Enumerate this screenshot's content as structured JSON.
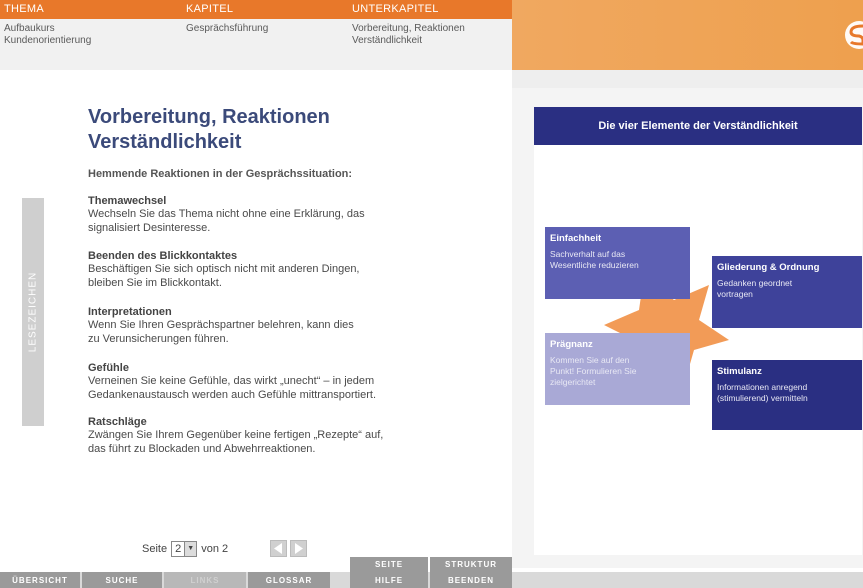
{
  "header": {
    "thema_label": "THEMA",
    "kapitel_label": "KAPITEL",
    "unterkapitel_label": "UNTERKAPITEL",
    "thema_value": "Aufbaukurs\nKundenorientierung",
    "kapitel_value": "Gesprächsführung",
    "unterkapitel_value": "Vorbereitung, Reaktionen\nVerständlichkeit"
  },
  "bookmark": {
    "label": "LESEZEICHEN"
  },
  "content": {
    "title": "Vorbereitung, Reaktionen Verständlichkeit",
    "subtitle": "Hemmende Reaktionen in der Gesprächssituation:",
    "sections": [
      {
        "heading": "Themawechsel",
        "text": "Wechseln Sie das Thema nicht ohne eine Erklärung, das\nsignalisiert Desinteresse."
      },
      {
        "heading": "Beenden des Blickkontaktes",
        "text": "Beschäftigen Sie sich optisch nicht mit anderen Dingen,\nbleiben Sie im Blickkontakt."
      },
      {
        "heading": "Interpretationen",
        "text": "Wenn Sie Ihren Gesprächspartner belehren, kann dies\nzu Verunsicherungen führen."
      },
      {
        "heading": "Gefühle",
        "text": "Verneinen Sie keine Gefühle, das wirkt „unecht“ – in jedem\nGedankenaustausch werden auch Gefühle mittransportiert."
      },
      {
        "heading": "Ratschläge",
        "text": "Zwängen Sie Ihrem Gegenüber keine fertigen „Rezepte“ auf,\ndas führt zu Blockaden und Abwehrreaktionen."
      }
    ]
  },
  "pager": {
    "seite_label": "Seite",
    "current": "2",
    "von_label": "von 2"
  },
  "diagram": {
    "title": "Die vier Elemente der Verständlichkeit",
    "cards": [
      {
        "title": "Einfachheit",
        "text": "Sachverhalt auf das\nWesentliche reduzieren"
      },
      {
        "title": "Gliederung & Ordnung",
        "text": "Gedanken geordnet\nvortragen"
      },
      {
        "title": "Prägnanz",
        "text": "Kommen Sie auf den\nPunkt! Formulieren Sie\nzielgerichtet"
      },
      {
        "title": "Stimulanz",
        "text": "Informationen anregend\n(stimulierend) vermitteln"
      }
    ],
    "accent_color": "#f0893a",
    "header_color": "#2a2f82"
  },
  "bottom": {
    "uebersicht": "ÜBERSICHT",
    "suche": "SUCHE",
    "links": "LINKS",
    "glossar": "GLOSSAR",
    "seite": "SEITE",
    "hilfe": "HILFE",
    "struktur": "STRUKTUR",
    "beenden": "BEENDEN"
  }
}
